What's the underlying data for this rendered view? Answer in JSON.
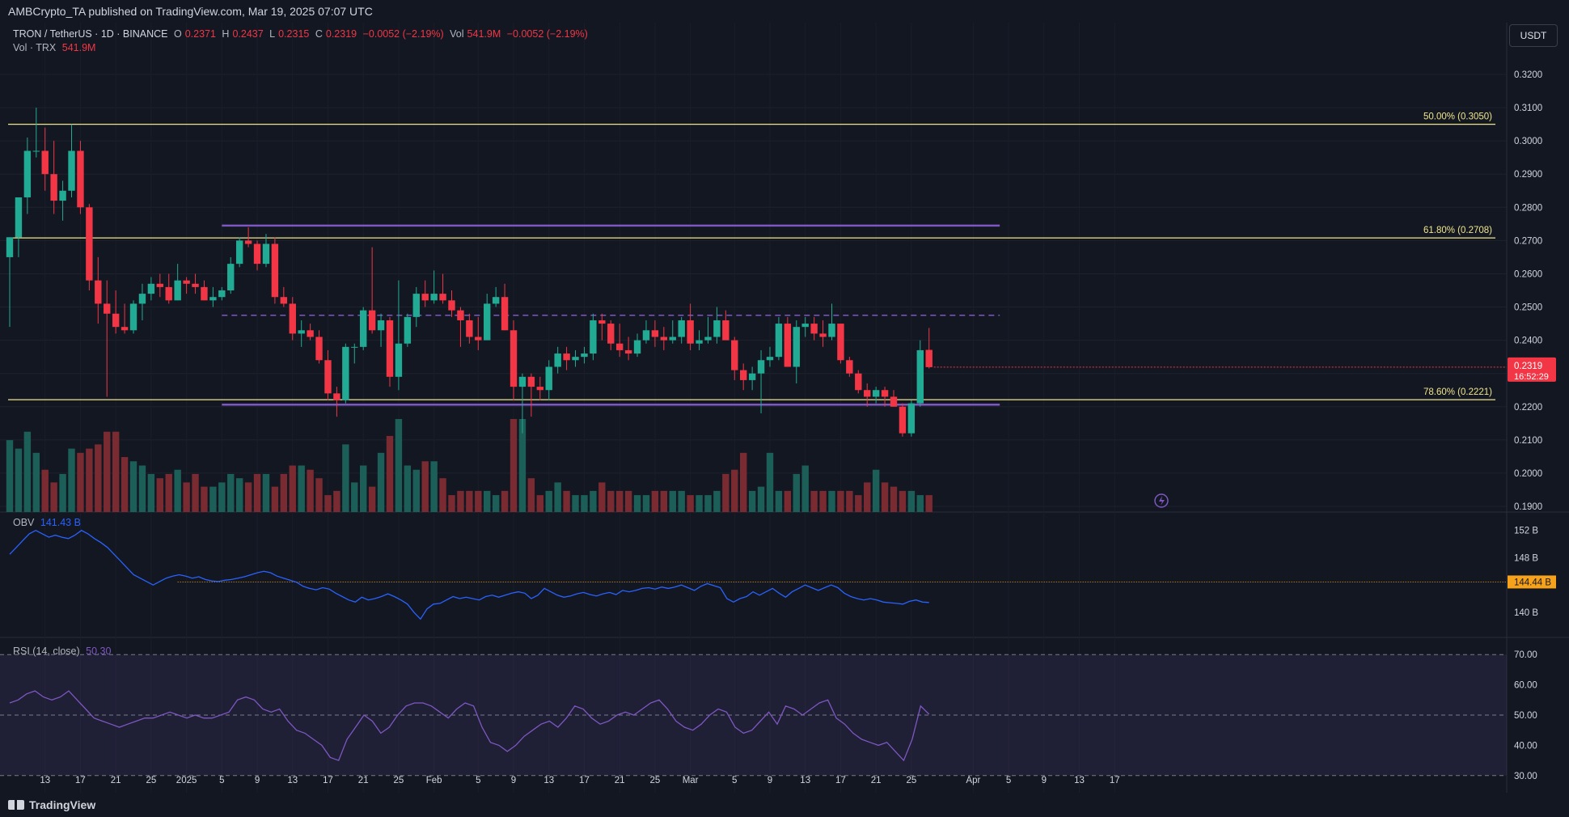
{
  "header": {
    "publisher_line": "AMBCrypto_TA published on TradingView.com, Mar 19, 2025 07:07 UTC"
  },
  "legend": {
    "symbol": "TRON / TetherUS · 1D · BINANCE",
    "o_label": "O",
    "o_value": "0.2371",
    "h_label": "H",
    "h_value": "0.2437",
    "l_label": "L",
    "l_value": "0.2315",
    "c_label": "C",
    "c_value": "0.2319",
    "change": "−0.0052 (−2.19%)",
    "vol_label": "Vol",
    "vol_value": "541.9M",
    "vol_change": "−0.0052 (−2.19%)",
    "vol_line_label": "Vol · TRX",
    "vol_line_value": "541.9M"
  },
  "currency_button": "USDT",
  "obv_legend": {
    "label": "OBV",
    "value": "141.43 B"
  },
  "rsi_legend": {
    "label": "RSI (14, close)",
    "value": "50.30"
  },
  "footer": {
    "brand": "TradingView"
  },
  "colors": {
    "up": "#22ab94",
    "down": "#f23645",
    "fib": "#f0e68c",
    "channel": "#7e57c2",
    "obv": "#2962ff",
    "rsi": "#7e57c2",
    "orange": "#f7a21b"
  },
  "chart_data": [
    {
      "type": "candlestick",
      "title": "TRON / TetherUS · 1D · BINANCE",
      "y_ticks": [
        "0.3200",
        "0.3100",
        "0.3000",
        "0.2900",
        "0.2800",
        "0.2700",
        "0.2600",
        "0.2500",
        "0.2400",
        "0.2300",
        "0.2200",
        "0.2100",
        "0.2000",
        "0.1900"
      ],
      "ylim": [
        0.19,
        0.325
      ],
      "x_ticks": [
        "13",
        "17",
        "21",
        "25",
        "2025",
        "5",
        "9",
        "13",
        "17",
        "21",
        "25",
        "Feb",
        "5",
        "9",
        "13",
        "17",
        "21",
        "25",
        "Mar",
        "5",
        "9",
        "13",
        "17",
        "21",
        "25",
        "Apr",
        "5",
        "9",
        "13",
        "17"
      ],
      "candles": [
        [
          0.265,
          0.271,
          0.244,
          0.271
        ],
        [
          0.271,
          0.283,
          0.265,
          0.283
        ],
        [
          0.283,
          0.301,
          0.278,
          0.297
        ],
        [
          0.297,
          0.31,
          0.295,
          0.297
        ],
        [
          0.297,
          0.304,
          0.285,
          0.29
        ],
        [
          0.29,
          0.3,
          0.278,
          0.282
        ],
        [
          0.282,
          0.288,
          0.276,
          0.285
        ],
        [
          0.285,
          0.305,
          0.283,
          0.297
        ],
        [
          0.297,
          0.3,
          0.278,
          0.28
        ],
        [
          0.28,
          0.281,
          0.255,
          0.258
        ],
        [
          0.258,
          0.265,
          0.245,
          0.251
        ],
        [
          0.251,
          0.258,
          0.223,
          0.248
        ],
        [
          0.248,
          0.255,
          0.242,
          0.244
        ],
        [
          0.244,
          0.251,
          0.242,
          0.243
        ],
        [
          0.243,
          0.252,
          0.242,
          0.251
        ],
        [
          0.251,
          0.257,
          0.246,
          0.254
        ],
        [
          0.254,
          0.259,
          0.252,
          0.257
        ],
        [
          0.257,
          0.26,
          0.253,
          0.256
        ],
        [
          0.256,
          0.26,
          0.251,
          0.252
        ],
        [
          0.252,
          0.263,
          0.252,
          0.258
        ],
        [
          0.258,
          0.259,
          0.254,
          0.257
        ],
        [
          0.257,
          0.26,
          0.254,
          0.256
        ],
        [
          0.256,
          0.258,
          0.252,
          0.252
        ],
        [
          0.252,
          0.256,
          0.25,
          0.253
        ],
        [
          0.253,
          0.256,
          0.252,
          0.255
        ],
        [
          0.255,
          0.265,
          0.254,
          0.263
        ],
        [
          0.263,
          0.271,
          0.262,
          0.27
        ],
        [
          0.27,
          0.274,
          0.268,
          0.269
        ],
        [
          0.269,
          0.27,
          0.261,
          0.263
        ],
        [
          0.263,
          0.272,
          0.262,
          0.269
        ],
        [
          0.269,
          0.271,
          0.251,
          0.253
        ],
        [
          0.253,
          0.256,
          0.25,
          0.251
        ],
        [
          0.251,
          0.253,
          0.24,
          0.242
        ],
        [
          0.242,
          0.246,
          0.238,
          0.243
        ],
        [
          0.243,
          0.245,
          0.24,
          0.241
        ],
        [
          0.241,
          0.243,
          0.233,
          0.234
        ],
        [
          0.234,
          0.237,
          0.222,
          0.224
        ],
        [
          0.224,
          0.226,
          0.217,
          0.222
        ],
        [
          0.222,
          0.239,
          0.221,
          0.238
        ],
        [
          0.238,
          0.239,
          0.233,
          0.238
        ],
        [
          0.238,
          0.25,
          0.237,
          0.249
        ],
        [
          0.249,
          0.268,
          0.242,
          0.243
        ],
        [
          0.243,
          0.248,
          0.238,
          0.246
        ],
        [
          0.246,
          0.247,
          0.226,
          0.229
        ],
        [
          0.229,
          0.258,
          0.225,
          0.239
        ],
        [
          0.239,
          0.248,
          0.238,
          0.247
        ],
        [
          0.247,
          0.256,
          0.244,
          0.254
        ],
        [
          0.254,
          0.258,
          0.25,
          0.252
        ],
        [
          0.252,
          0.261,
          0.251,
          0.254
        ],
        [
          0.254,
          0.26,
          0.251,
          0.252
        ],
        [
          0.252,
          0.255,
          0.247,
          0.249
        ],
        [
          0.249,
          0.25,
          0.238,
          0.246
        ],
        [
          0.246,
          0.248,
          0.239,
          0.241
        ],
        [
          0.241,
          0.247,
          0.237,
          0.24
        ],
        [
          0.24,
          0.254,
          0.24,
          0.251
        ],
        [
          0.251,
          0.256,
          0.25,
          0.253
        ],
        [
          0.253,
          0.257,
          0.243,
          0.243
        ],
        [
          0.243,
          0.246,
          0.222,
          0.226
        ],
        [
          0.226,
          0.23,
          0.212,
          0.229
        ],
        [
          0.229,
          0.23,
          0.217,
          0.226
        ],
        [
          0.226,
          0.229,
          0.222,
          0.225
        ],
        [
          0.225,
          0.234,
          0.222,
          0.232
        ],
        [
          0.232,
          0.238,
          0.23,
          0.236
        ],
        [
          0.236,
          0.238,
          0.231,
          0.234
        ],
        [
          0.234,
          0.237,
          0.232,
          0.235
        ],
        [
          0.235,
          0.238,
          0.233,
          0.236
        ],
        [
          0.236,
          0.248,
          0.234,
          0.246
        ],
        [
          0.246,
          0.248,
          0.24,
          0.245
        ],
        [
          0.245,
          0.246,
          0.237,
          0.239
        ],
        [
          0.239,
          0.245,
          0.235,
          0.237
        ],
        [
          0.237,
          0.241,
          0.234,
          0.236
        ],
        [
          0.236,
          0.242,
          0.235,
          0.24
        ],
        [
          0.24,
          0.246,
          0.239,
          0.243
        ],
        [
          0.243,
          0.246,
          0.238,
          0.241
        ],
        [
          0.241,
          0.244,
          0.237,
          0.24
        ],
        [
          0.24,
          0.246,
          0.239,
          0.241
        ],
        [
          0.241,
          0.247,
          0.239,
          0.246
        ],
        [
          0.246,
          0.251,
          0.237,
          0.239
        ],
        [
          0.239,
          0.243,
          0.237,
          0.24
        ],
        [
          0.24,
          0.247,
          0.239,
          0.241
        ],
        [
          0.241,
          0.25,
          0.239,
          0.246
        ],
        [
          0.246,
          0.249,
          0.244,
          0.24
        ],
        [
          0.24,
          0.241,
          0.228,
          0.231
        ],
        [
          0.231,
          0.233,
          0.225,
          0.228
        ],
        [
          0.228,
          0.232,
          0.225,
          0.23
        ],
        [
          0.23,
          0.237,
          0.218,
          0.234
        ],
        [
          0.234,
          0.238,
          0.232,
          0.235
        ],
        [
          0.235,
          0.247,
          0.234,
          0.245
        ],
        [
          0.245,
          0.247,
          0.234,
          0.232
        ],
        [
          0.232,
          0.246,
          0.227,
          0.244
        ],
        [
          0.244,
          0.247,
          0.241,
          0.245
        ],
        [
          0.245,
          0.247,
          0.24,
          0.242
        ],
        [
          0.242,
          0.246,
          0.238,
          0.241
        ],
        [
          0.241,
          0.251,
          0.24,
          0.245
        ],
        [
          0.245,
          0.245,
          0.233,
          0.234
        ],
        [
          0.234,
          0.235,
          0.229,
          0.23
        ],
        [
          0.23,
          0.231,
          0.224,
          0.225
        ],
        [
          0.225,
          0.227,
          0.22,
          0.223
        ],
        [
          0.223,
          0.226,
          0.221,
          0.225
        ],
        [
          0.225,
          0.226,
          0.22,
          0.223
        ],
        [
          0.223,
          0.225,
          0.22,
          0.22
        ],
        [
          0.22,
          0.221,
          0.211,
          0.212
        ],
        [
          0.212,
          0.222,
          0.211,
          0.221
        ],
        [
          0.221,
          0.24,
          0.22,
          0.237
        ],
        [
          0.2371,
          0.2437,
          0.2315,
          0.2319
        ]
      ],
      "volume": [
        85,
        75,
        95,
        70,
        50,
        35,
        45,
        75,
        70,
        75,
        80,
        95,
        95,
        65,
        60,
        55,
        45,
        40,
        45,
        50,
        35,
        45,
        30,
        30,
        35,
        45,
        40,
        35,
        45,
        45,
        30,
        45,
        55,
        55,
        50,
        40,
        20,
        25,
        80,
        35,
        55,
        30,
        70,
        90,
        110,
        55,
        50,
        60,
        60,
        40,
        20,
        25,
        25,
        25,
        25,
        20,
        25,
        110,
        110,
        40,
        20,
        25,
        35,
        25,
        20,
        20,
        25,
        35,
        25,
        25,
        25,
        20,
        20,
        25,
        25,
        25,
        25,
        20,
        20,
        20,
        25,
        45,
        50,
        70,
        25,
        30,
        70,
        25,
        25,
        45,
        55,
        25,
        25,
        25,
        25,
        25,
        20,
        35,
        50,
        35,
        30,
        25,
        25,
        20,
        20,
        25,
        30,
        40,
        25
      ],
      "last_price": "0.2319",
      "countdown": "16:52:29",
      "fib_levels": [
        {
          "label": "50.00% (0.3050)",
          "value": 0.305
        },
        {
          "label": "61.80% (0.2708)",
          "value": 0.2708
        },
        {
          "label": "78.60% (0.2221)",
          "value": 0.2221
        }
      ],
      "channel": {
        "upper": 0.2745,
        "mid": 0.2475,
        "lower": 0.2206
      }
    },
    {
      "type": "line",
      "title": "OBV",
      "value_label": "141.43 B",
      "y_ticks": [
        "152 B",
        "148 B",
        "140 B"
      ],
      "ylim": [
        137.5,
        153.5
      ],
      "level": 144.44,
      "level_label": "144.44 B",
      "values": [
        148.5,
        149.5,
        150.5,
        151.5,
        152,
        151.5,
        151,
        151.3,
        151,
        150.8,
        151.3,
        152,
        151.5,
        150.8,
        150.2,
        149.5,
        148.5,
        147.5,
        146.5,
        145.5,
        145,
        144.5,
        144,
        144.5,
        145,
        145.3,
        145.5,
        145.3,
        145,
        145.2,
        144.8,
        144.6,
        144.5,
        144.7,
        144.8,
        145,
        145.2,
        145.5,
        145.8,
        146,
        145.8,
        145.3,
        145,
        144.7,
        144.4,
        143.8,
        143.5,
        143.3,
        143.6,
        143.4,
        142.8,
        142.3,
        141.8,
        141.5,
        142.2,
        141.8,
        142,
        142.3,
        142.7,
        142.3,
        141.8,
        141.2,
        140,
        139,
        140.5,
        141.2,
        141.3,
        141.8,
        142.3,
        142,
        142.2,
        142,
        141.8,
        142.3,
        142.5,
        142.2,
        142.5,
        142.8,
        143,
        142.8,
        142,
        142.5,
        143.5,
        143,
        142.5,
        142.2,
        142.4,
        142.7,
        142.9,
        142.6,
        142.4,
        142.7,
        142.9,
        142.6,
        143.2,
        143,
        143.2,
        143.5,
        143.6,
        143.4,
        143.7,
        143.5,
        143.7,
        144,
        143.6,
        143.2,
        143.8,
        144.2,
        143.9,
        143.6,
        142,
        141.5,
        142,
        142.3,
        143,
        142.5,
        143,
        143.5,
        142.8,
        142.2,
        143,
        143.5,
        144,
        143.6,
        143.2,
        143.6,
        144,
        143.6,
        142.8,
        142.3,
        142,
        141.8,
        142,
        141.8,
        141.5,
        141.4,
        141.3,
        141.2,
        141.6,
        141.8,
        141.5,
        141.43
      ]
    },
    {
      "type": "line",
      "title": "RSI (14, close)",
      "value_label": "50.30",
      "y_ticks": [
        "70.00",
        "60.00",
        "50.00",
        "40.00",
        "30.00"
      ],
      "ylim": [
        27,
        73
      ],
      "band": [
        30,
        70
      ],
      "mid": 50,
      "values": [
        54,
        55,
        57,
        58,
        56,
        55,
        56,
        58,
        55,
        52,
        49,
        48,
        47,
        46,
        47,
        48,
        49,
        49,
        50,
        51,
        50,
        49,
        50,
        49,
        49,
        50,
        51,
        55,
        56,
        55,
        52,
        51,
        52,
        48,
        45,
        44,
        42,
        40,
        36,
        35,
        42,
        46,
        50,
        48,
        44,
        46,
        50,
        53,
        54,
        54,
        53,
        51,
        49,
        52,
        54,
        53,
        46,
        41,
        40,
        38,
        40,
        43,
        45,
        47,
        48,
        46,
        49,
        53,
        52,
        49,
        47,
        48,
        50,
        51,
        50,
        52,
        54,
        55,
        52,
        48,
        46,
        45,
        47,
        50,
        52,
        51,
        46,
        44,
        45,
        48,
        51,
        47,
        53,
        52,
        50,
        52,
        54,
        55,
        49,
        47,
        44,
        42,
        41,
        40,
        41,
        38,
        35,
        42,
        53,
        50.3
      ]
    }
  ]
}
